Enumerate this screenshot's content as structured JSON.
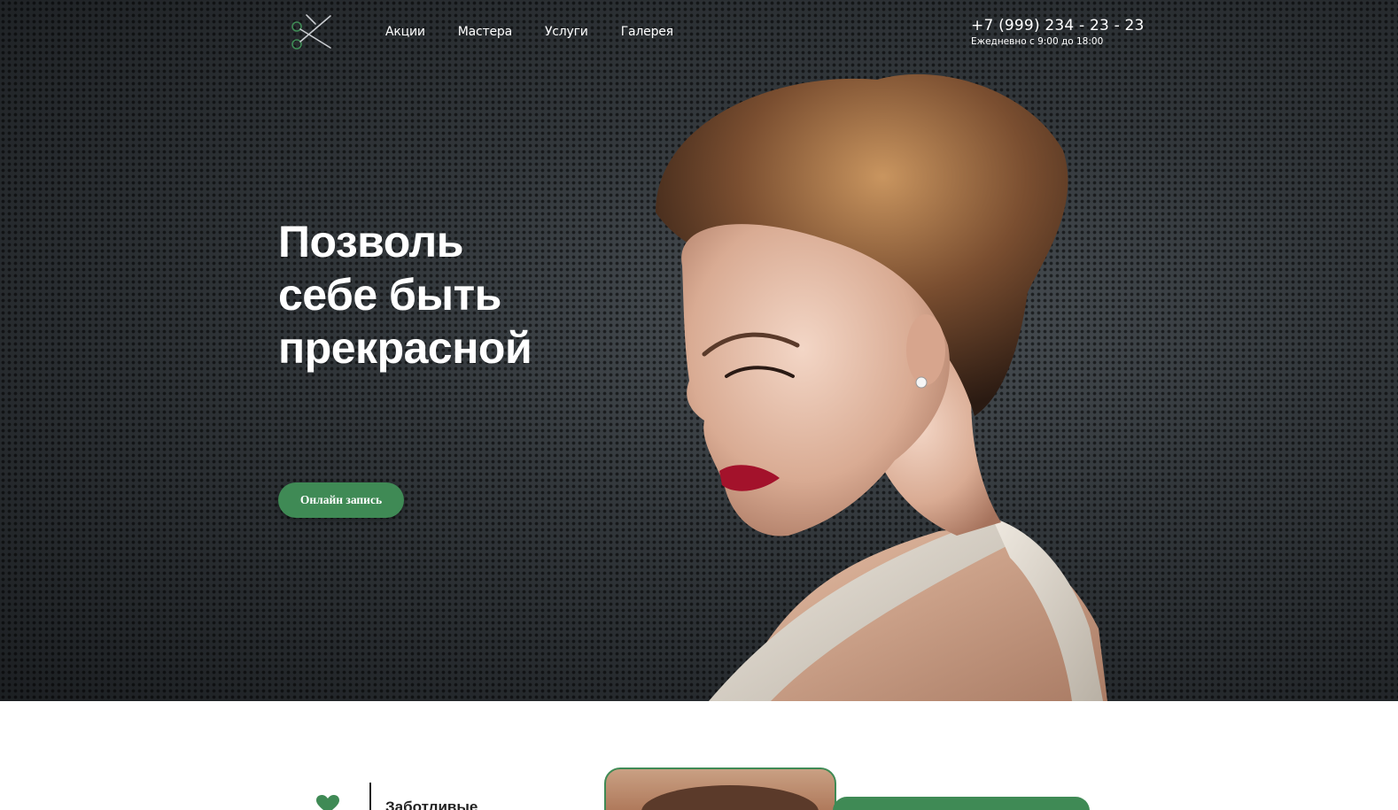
{
  "header": {
    "logo": "scissors-logo",
    "nav": [
      "Акции",
      "Мастера",
      "Услуги",
      "Галерея"
    ],
    "phone": "+7 (999) 234 - 23 - 23",
    "hours": "Ежедневно с 9:00 до 18:00"
  },
  "hero": {
    "headline": [
      "Позволь",
      "себе быть",
      "прекрасной"
    ],
    "cta_label": "Онлайн запись"
  },
  "section2": {
    "feature_title": "Заботливые"
  },
  "colors": {
    "accent": "#3f8a55",
    "hero_bg": "#2e3236",
    "text_light": "#ffffff"
  }
}
